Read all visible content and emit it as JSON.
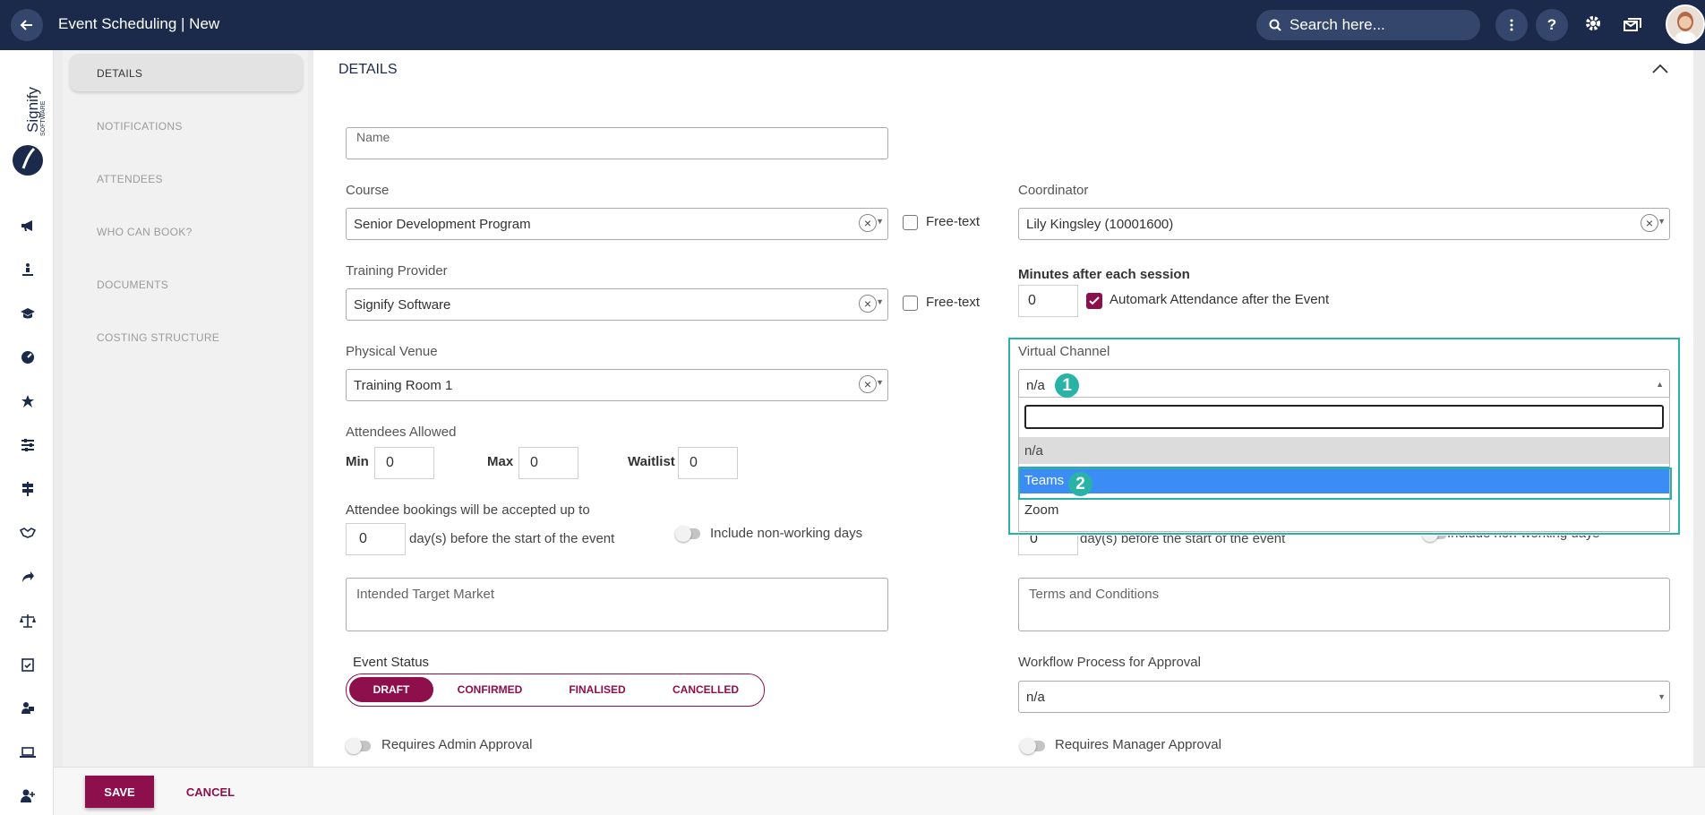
{
  "header": {
    "title": "Event Scheduling | New",
    "search_placeholder": "Search here...",
    "help_label": "?"
  },
  "subnav": {
    "items": [
      "DETAILS",
      "NOTIFICATIONS",
      "ATTENDEES",
      "WHO CAN BOOK?",
      "DOCUMENTS",
      "COSTING STRUCTURE"
    ]
  },
  "section": {
    "title": "DETAILS"
  },
  "form": {
    "name_placeholder": "Name",
    "course_label": "Course",
    "course_value": "Senior Development Program",
    "free_text_label": "Free-text",
    "training_provider_label": "Training Provider",
    "training_provider_value": "Signify Software",
    "physical_venue_label": "Physical Venue",
    "physical_venue_value": "Training Room 1",
    "coordinator_label": "Coordinator",
    "coordinator_value": "Lily Kingsley (10001600)",
    "minutes_label": "Minutes after each session",
    "minutes_value": "0",
    "automark_label": "Automark Attendance after the Event",
    "virtual_channel_label": "Virtual Channel",
    "virtual_channel_value": "n/a",
    "virtual_channel_options": [
      "n/a",
      "Teams",
      "Zoom"
    ],
    "attendees_allowed_label": "Attendees Allowed",
    "min_label": "Min",
    "min_value": "0",
    "max_label": "Max",
    "max_value": "0",
    "waitlist_label": "Waitlist",
    "waitlist_value": "0",
    "bookings_label": "Attendee bookings will be accepted up to",
    "bookings_value": "0",
    "days_before_label": "day(s) before the start of the event",
    "include_nonworking_label": "Include non-working days",
    "right_days_value": "0",
    "right_days_label": "day(s) before the start of the event",
    "right_include_label": "Include non-working days",
    "target_market_placeholder": "Intended Target Market",
    "terms_placeholder": "Terms and Conditions",
    "event_status_label": "Event Status",
    "status_options": [
      "DRAFT",
      "CONFIRMED",
      "FINALISED",
      "CANCELLED"
    ],
    "workflow_label": "Workflow Process for Approval",
    "workflow_value": "n/a",
    "admin_approval_label": "Requires Admin Approval",
    "manager_approval_label": "Requires Manager Approval"
  },
  "annotations": {
    "badge_1": "1",
    "badge_2": "2"
  },
  "footer": {
    "save_label": "SAVE",
    "cancel_label": "CANCEL"
  },
  "colors": {
    "header_bg": "#1b2a4a",
    "brand": "#8d0f4c",
    "highlight": "#29b3a7",
    "selected_option": "#3b8cf5"
  },
  "icons": {
    "rail": [
      "megaphone-icon",
      "presenter-icon",
      "graduation-cap-icon",
      "dashboard-icon",
      "star-icon",
      "sliders-icon",
      "signpost-icon",
      "handshake-icon",
      "share-icon",
      "scales-icon",
      "calendar-check-icon",
      "user-board-icon",
      "laptop-icon",
      "add-user-icon"
    ]
  }
}
